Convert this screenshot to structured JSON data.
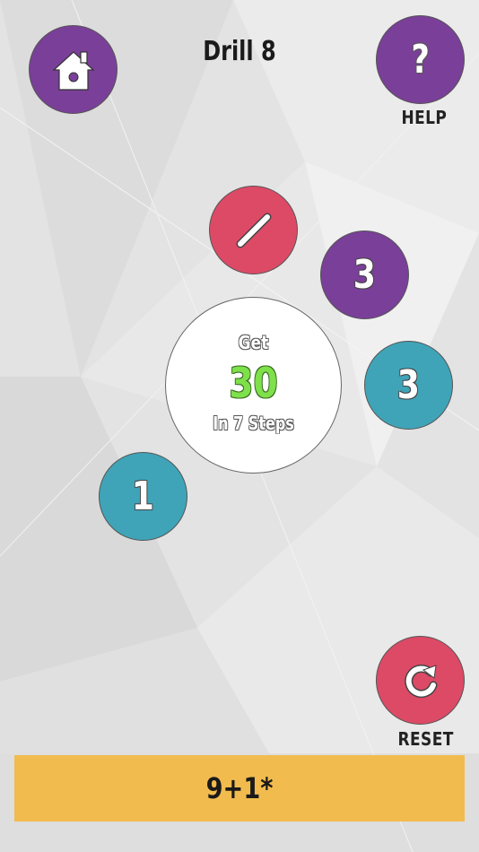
{
  "header": {
    "title": "Drill 8"
  },
  "buttons": {
    "home_icon": "house-icon",
    "help_icon": "question-mark-icon",
    "help_label": "HELP",
    "reset_icon": "refresh-icon",
    "reset_label": "RESET"
  },
  "target": {
    "prefix": "Get",
    "value": "30",
    "suffix": "In 7 Steps"
  },
  "tiles": [
    {
      "id": "divide",
      "symbol": "/",
      "color": "#dd4a66"
    },
    {
      "id": "purple-3",
      "value": "3",
      "color": "#7a3f98"
    },
    {
      "id": "teal-3",
      "value": "3",
      "color": "#3fa4b8"
    },
    {
      "id": "teal-1",
      "value": "1",
      "color": "#3fa4b8"
    }
  ],
  "expression": {
    "text": "9+1*"
  },
  "colors": {
    "purple": "#7a3f98",
    "red": "#dd4a66",
    "teal": "#3fa4b8",
    "target_green": "#7ee04a",
    "bar": "#f2bb4e"
  }
}
